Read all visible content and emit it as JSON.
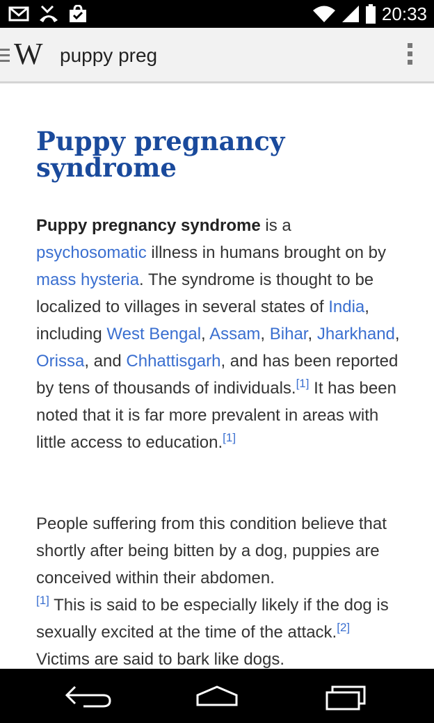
{
  "statusbar": {
    "time": "20:33",
    "icons": [
      "gmail-icon",
      "missed-call-icon",
      "shopping-bag-check-icon",
      "wifi-icon",
      "signal-icon",
      "battery-icon"
    ]
  },
  "appbar": {
    "logo": "W",
    "search_value": "puppy preg"
  },
  "article": {
    "title": "Puppy pregnancy syndrome",
    "p1": {
      "bold": "Puppy pregnancy syndrome",
      "t1": " is a ",
      "l1": "psychosomatic",
      "t2": " illness in humans brought on by ",
      "l2": "mass hysteria",
      "t3": ". The syndrome is thought to be localized to villages in several states of ",
      "l3": "India",
      "t4": ", including ",
      "l4": "West Bengal",
      "t5": ", ",
      "l5": "Assam",
      "t6": ", ",
      "l6": "Bihar",
      "t7": ", ",
      "l7": "Jharkhand",
      "t8": ", ",
      "l8": "Orissa",
      "t9": ", and ",
      "l9": "Chhattisgarh",
      "t10": ", and has been reported by tens of thousands of individuals.",
      "ref1": "[1]",
      "t11": " It has been noted that it is far more prevalent in areas with little access to education.",
      "ref2": "[1]"
    },
    "p2": {
      "t1": "People suffering from this condition believe that shortly after being bitten by a dog, puppies are conceived within their abdomen.",
      "ref1": "[1]",
      "t2": " This is said to be especially likely if the dog is sexually excited at the time of the attack.",
      "ref2": "[2]",
      "t3": " Victims are said to bark like dogs."
    }
  },
  "navbar": {
    "buttons": [
      "back-icon",
      "home-icon",
      "recent-apps-icon"
    ]
  },
  "colors": {
    "title": "#1a4a9c",
    "link": "#3a6fd0",
    "text": "#333333",
    "appbar_bg": "#f2f2f2"
  }
}
